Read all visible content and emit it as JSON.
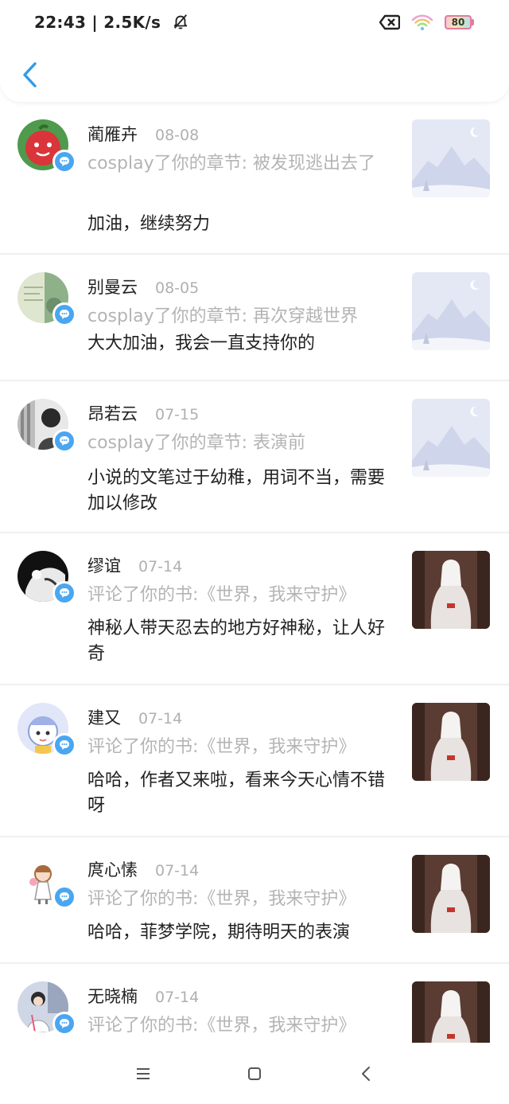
{
  "status_bar": {
    "time": "22:43 | 2.5K/s",
    "battery": "80"
  },
  "icons": {
    "back": "chevron-left-icon",
    "badge": "chat-bubble-icon",
    "nav_menu": "menu-icon",
    "nav_home": "home-icon",
    "nav_back": "back-icon"
  },
  "colors": {
    "accent": "#4aa6f0",
    "name": "#222222",
    "muted": "#b4b4b4"
  },
  "items": [
    {
      "name": "蔺雁卉",
      "date": "08-08",
      "action": "cosplay了你的章节: 被发现逃出去了",
      "comment": "加油，继续努力",
      "thumb": "placeholder"
    },
    {
      "name": "别曼云",
      "date": "08-05",
      "action": "cosplay了你的章节: 再次穿越世界",
      "comment": "大大加油，我会一直支持你的",
      "thumb": "placeholder"
    },
    {
      "name": "昂若云",
      "date": "07-15",
      "action": "cosplay了你的章节: 表演前",
      "comment": "小说的文笔过于幼稚，用词不当，需要加以修改",
      "thumb": "placeholder"
    },
    {
      "name": "缪谊",
      "date": "07-14",
      "action": "评论了你的书:《世界，我来守护》",
      "comment": "神秘人带天忍去的地方好神秘，让人好奇",
      "thumb": "book-cover"
    },
    {
      "name": "建又",
      "date": "07-14",
      "action": "评论了你的书:《世界，我来守护》",
      "comment": "哈哈，作者又来啦，看来今天心情不错呀",
      "thumb": "book-cover"
    },
    {
      "name": "庹心愫",
      "date": "07-14",
      "action": "评论了你的书:《世界，我来守护》",
      "comment": "哈哈，菲梦学院，期待明天的表演",
      "thumb": "book-cover"
    },
    {
      "name": "无晓楠",
      "date": "07-14",
      "action": "评论了你的书:《世界，我来守护》",
      "comment": "",
      "thumb": "book-cover"
    }
  ]
}
